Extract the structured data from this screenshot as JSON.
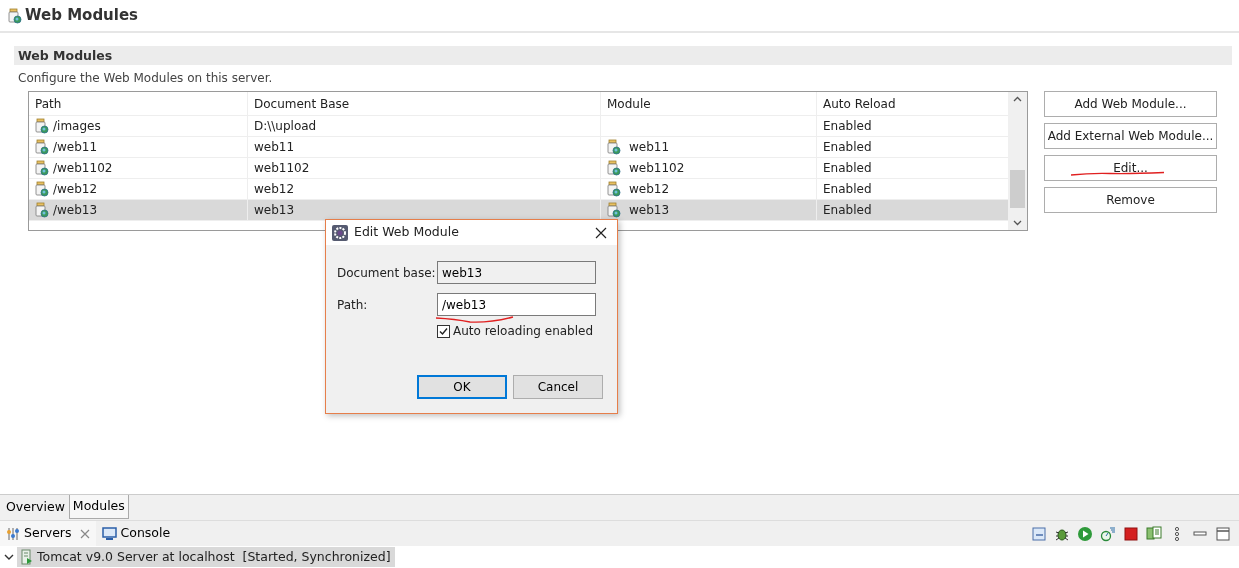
{
  "editor": {
    "title": "Web Modules"
  },
  "section": {
    "title": "Web Modules",
    "description": "Configure the Web Modules on this server."
  },
  "table": {
    "columns": [
      "Path",
      "Document Base",
      "Module",
      "Auto Reload"
    ],
    "rows": [
      {
        "path": "/images",
        "document_base": "D:\\\\upload",
        "module": "",
        "auto_reload": "Enabled",
        "selected": false
      },
      {
        "path": "/web11",
        "document_base": "web11",
        "module": "web11",
        "auto_reload": "Enabled",
        "selected": false
      },
      {
        "path": "/web1102",
        "document_base": "web1102",
        "module": "web1102",
        "auto_reload": "Enabled",
        "selected": false
      },
      {
        "path": "/web12",
        "document_base": "web12",
        "module": "web12",
        "auto_reload": "Enabled",
        "selected": false
      },
      {
        "path": "/web13",
        "document_base": "web13",
        "module": "web13",
        "auto_reload": "Enabled",
        "selected": true
      }
    ]
  },
  "buttons": [
    "Add Web Module...",
    "Add External Web Module...",
    "Edit...",
    "Remove"
  ],
  "dialog": {
    "title": "Edit Web Module",
    "fields": [
      {
        "label": "Document base:",
        "value": "web13"
      },
      {
        "label": "Path:",
        "value": "/web13"
      }
    ],
    "checkbox": {
      "label": "Auto reloading enabled",
      "checked": true
    },
    "buttons": [
      "OK",
      "Cancel"
    ]
  },
  "editor_tabs": [
    {
      "label": "Overview",
      "selected": false
    },
    {
      "label": "Modules",
      "selected": true
    }
  ],
  "views": [
    {
      "label": "Servers",
      "selected": true
    },
    {
      "label": "Console",
      "selected": false
    }
  ],
  "servers": [
    {
      "label": "Tomcat v9.0 Server at localhost  [Started, Synchronized]",
      "expanded": true
    }
  ]
}
